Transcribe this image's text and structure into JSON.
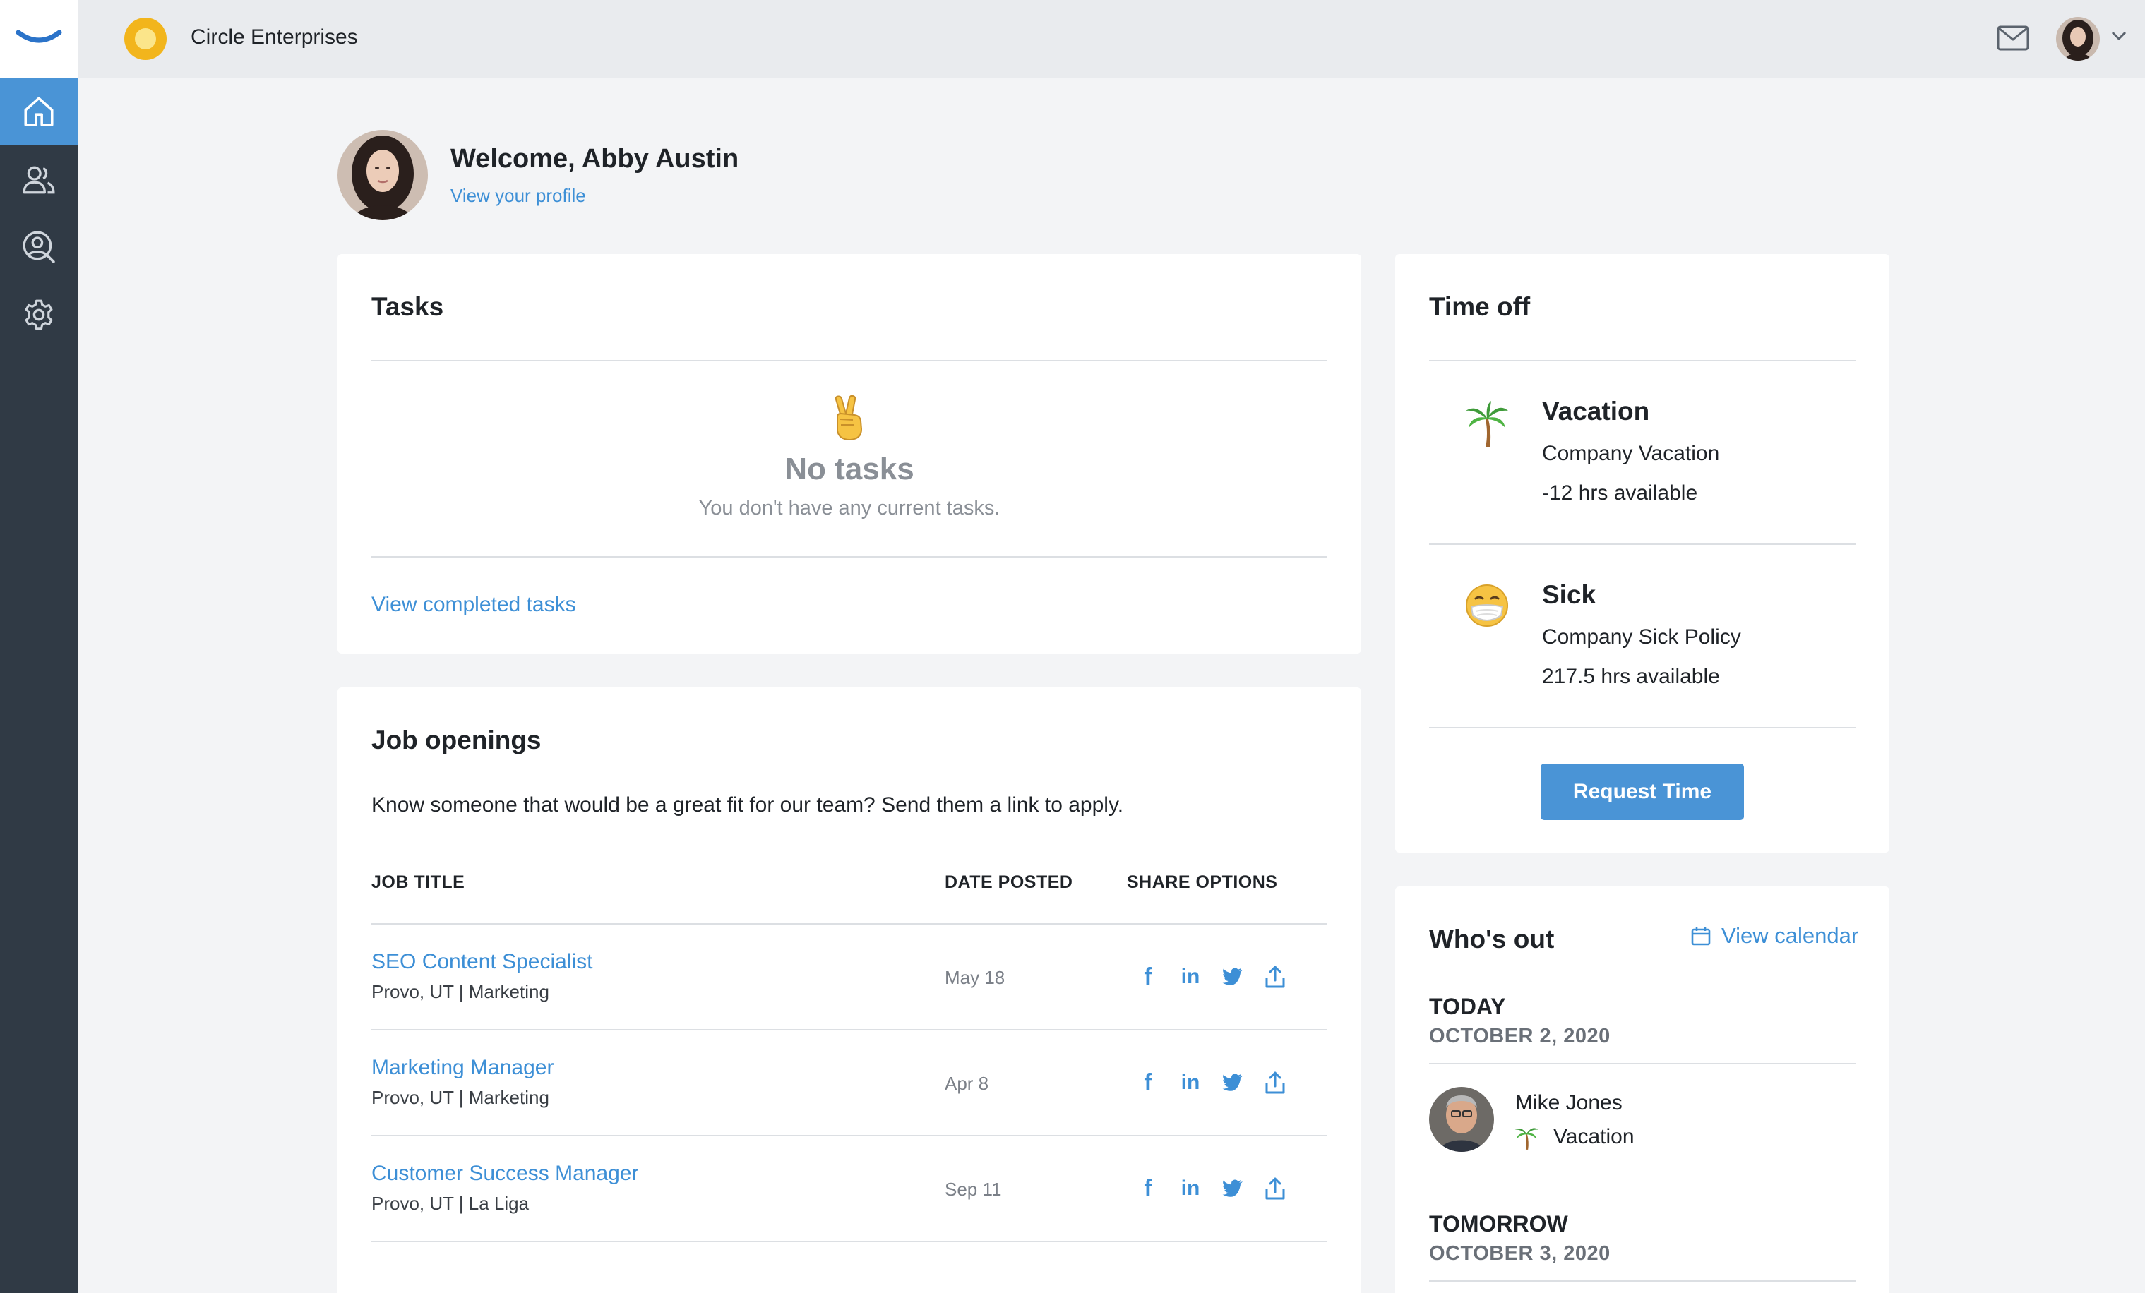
{
  "company": {
    "name": "Circle Enterprises"
  },
  "header": {
    "mail_icon": "mail-icon",
    "avatar": "user-avatar"
  },
  "sidebar": {
    "items": [
      {
        "name": "home",
        "icon": "home-icon"
      },
      {
        "name": "people",
        "icon": "people-icon"
      },
      {
        "name": "directory",
        "icon": "user-search-icon"
      },
      {
        "name": "settings",
        "icon": "gear-icon"
      }
    ]
  },
  "welcome": {
    "greeting": "Welcome, Abby Austin",
    "profile_link": "View your profile"
  },
  "tasks": {
    "title": "Tasks",
    "empty_title": "No tasks",
    "empty_subtitle": "You don't have any current tasks.",
    "completed_link": "View completed tasks"
  },
  "jobs": {
    "title": "Job openings",
    "description": "Know someone that would be a great fit for our team? Send them a link to apply.",
    "columns": {
      "title": "JOB TITLE",
      "date": "DATE POSTED",
      "share": "SHARE OPTIONS"
    },
    "rows": [
      {
        "title": "SEO Content Specialist",
        "location": "Provo, UT | Marketing",
        "date": "May 18"
      },
      {
        "title": "Marketing Manager",
        "location": "Provo, UT | Marketing",
        "date": "Apr 8"
      },
      {
        "title": "Customer Success Manager",
        "location": "Provo, UT | La Liga",
        "date": "Sep 11"
      }
    ]
  },
  "time_off": {
    "title": "Time off",
    "items": [
      {
        "type": "Vacation",
        "policy": "Company Vacation",
        "hours": "-12 hrs available",
        "icon": "palm-tree-icon"
      },
      {
        "type": "Sick",
        "policy": "Company Sick Policy",
        "hours": "217.5 hrs available",
        "icon": "sick-face-icon"
      }
    ],
    "button": "Request Time"
  },
  "whos_out": {
    "title": "Who's out",
    "calendar_link": "View calendar",
    "today_label": "TODAY",
    "today_date": "OCTOBER 2, 2020",
    "person": {
      "name": "Mike Jones",
      "type": "Vacation"
    },
    "tomorrow_label": "TOMORROW",
    "tomorrow_date": "OCTOBER 3, 2020"
  },
  "colors": {
    "accent": "#4a94d6",
    "link": "#3d8fd6",
    "sidebar": "#303a45",
    "background": "#f3f4f6"
  }
}
